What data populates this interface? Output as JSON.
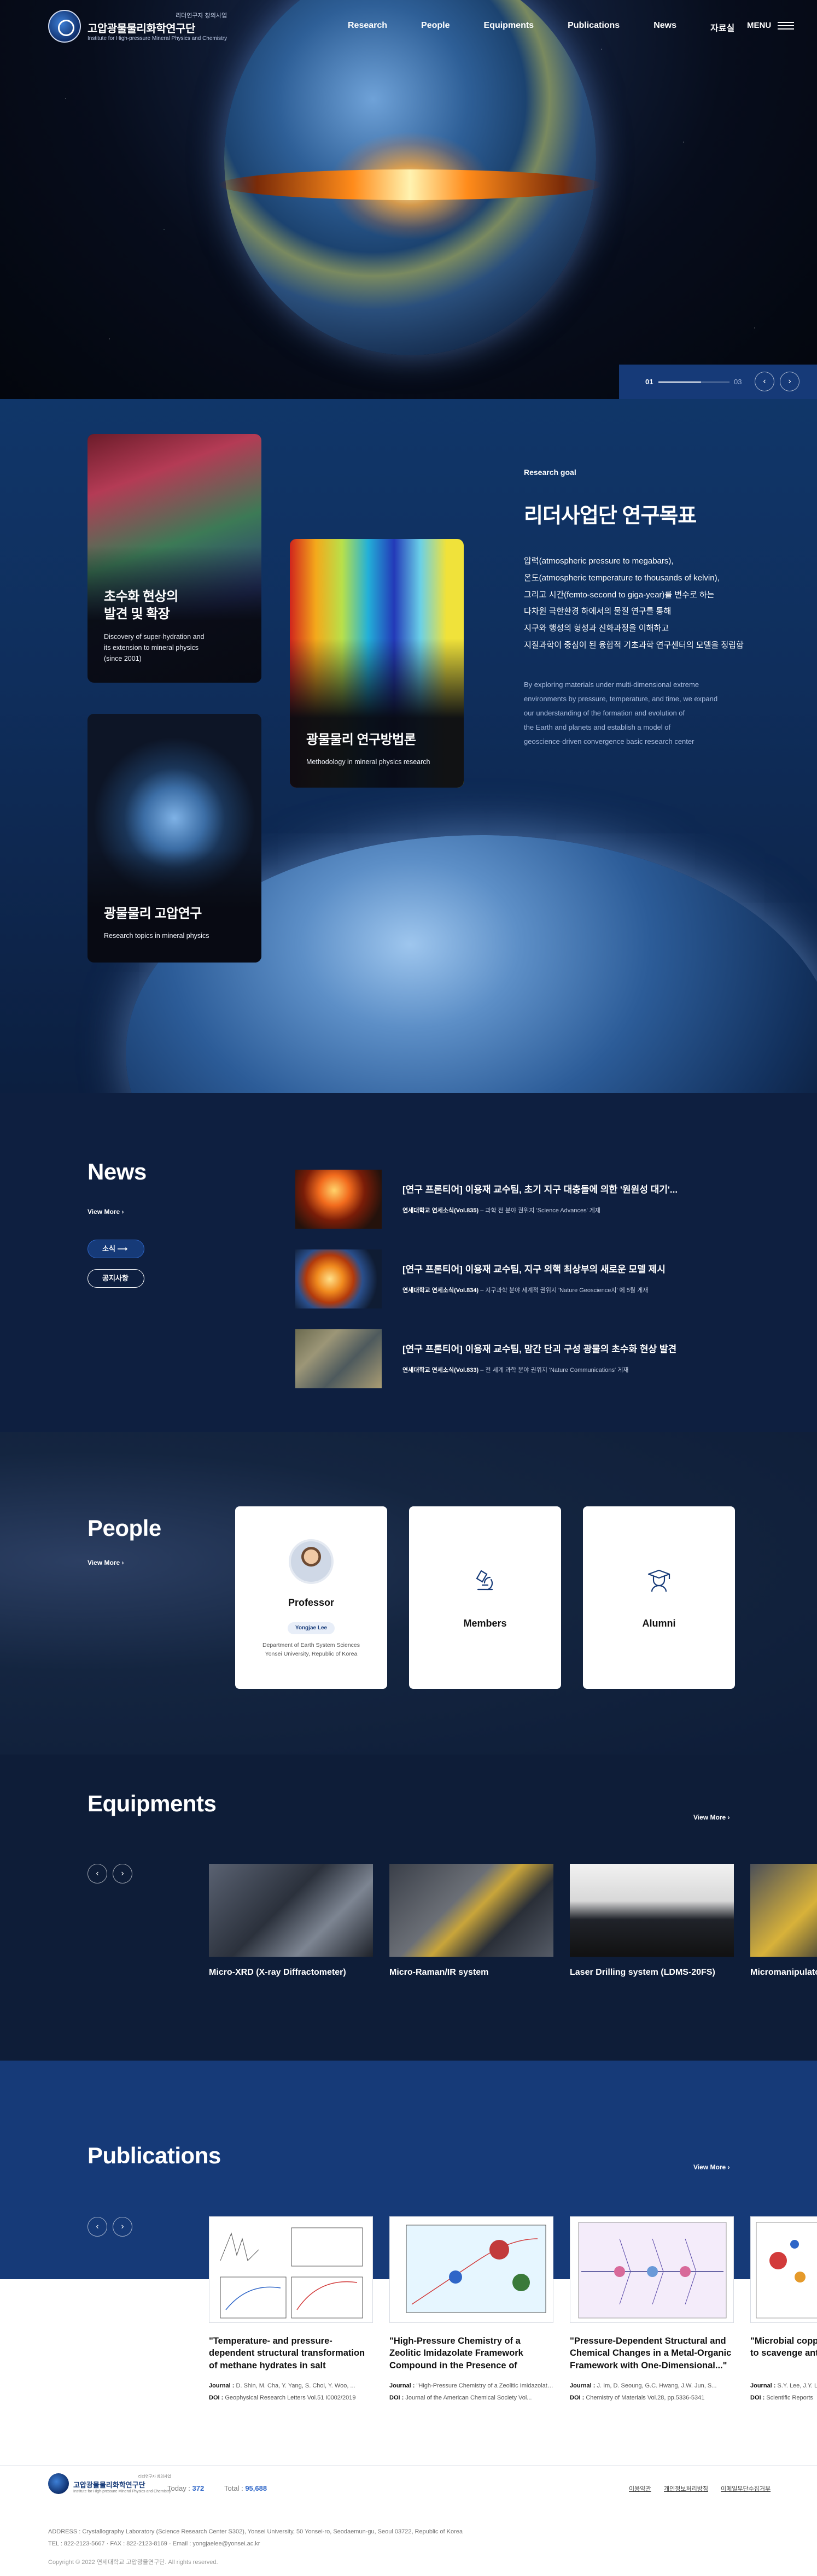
{
  "header": {
    "logo_kicker": "리더연구자 창의사업",
    "logo_name": "고압광물물리화학연구단",
    "logo_eng": "Institute for High-pressure Mineral Physics and Chemistry",
    "nav": [
      "Research",
      "People",
      "Equipments",
      "Publications",
      "News",
      "자료실"
    ],
    "menu_label": "MENU"
  },
  "hero": {
    "current_slide": "01",
    "total_slides": "03",
    "progress": 0.6,
    "prev_glyph": "‹",
    "next_glyph": "›"
  },
  "research": {
    "cards": [
      {
        "title_line1": "초수화 현상의",
        "title_line2": "발견 및 확장",
        "desc_line1": "Discovery of super-hydration and",
        "desc_line2": "its extension to mineral physics",
        "desc_line3": "(since 2001)"
      },
      {
        "title_line1": "광물물리 연구방법론",
        "desc_line1": "Methodology in mineral physics research"
      },
      {
        "title_line1": "광물물리 고압연구",
        "desc_line1": "Research topics in mineral physics"
      }
    ],
    "goal_kicker": "Research goal",
    "goal_title": "리더사업단 연구목표",
    "goal_ko": [
      "압력(atmospheric pressure to megabars),",
      "온도(atmospheric temperature to thousands of kelvin),",
      "그리고 시간(femto-second to giga-year)를 변수로 하는",
      "다차원 극한환경 하에서의 물질 연구를 통해",
      "지구와 행성의 형성과 진화과정을 이해하고",
      "지질과학이 중심이 된 융합적 기초과학 연구센터의 모델을 정립함"
    ],
    "goal_en": [
      "By exploring materials under multi-dimensional extreme",
      "environments by pressure, temperature, and time, we expand",
      "our understanding of the formation and evolution of",
      "the Earth and planets and establish a model of",
      "geoscience-driven convergence basic research center"
    ]
  },
  "news": {
    "title": "News",
    "view_more": "View More",
    "tabs": [
      "소식",
      "공지사항"
    ],
    "items": [
      {
        "title": "[연구 프론티어] 이용재 교수팀, 초기 지구 대충돌에 의한 '원원성 대기'...",
        "source": "연세대학교 연세소식(Vol.835)",
        "note": "과학 전 분야 권위지 'Science Advances' 게재"
      },
      {
        "title": "[연구 프론티어] 이용재 교수팀, 지구 외핵 최상부의 새로운 모델 제시",
        "source": "연세대학교 연세소식(Vol.834)",
        "note": "지구과학 분야 세계적 권위지 'Nature Geoscience지' 에 5월 게재"
      },
      {
        "title": "[연구 프론티어] 이용재 교수팀, 맘간 단괴 구성 광물의 초수화 현상 발견",
        "source": "연세대학교 연세소식(Vol.833)",
        "note": "전 세계 과학 분야 권위지 'Nature Communications' 게재"
      }
    ]
  },
  "people": {
    "title": "People",
    "view_more": "View More",
    "professor": {
      "label": "Professor",
      "name": "Yongjae Lee",
      "dept_line1": "Department of Earth System Sciences",
      "dept_line2": "Yonsei University, Republic of Korea"
    },
    "members_label": "Members",
    "alumni_label": "Alumni"
  },
  "equipments": {
    "title": "Equipments",
    "view_more": "View More",
    "items": [
      "Micro-XRD (X-ray Diffractometer)",
      "Micro-Raman/IR system",
      "Laser Drilling system (LDMS-20FS)",
      "Micromanipulator"
    ]
  },
  "publications": {
    "title": "Publications",
    "view_more": "View More",
    "items": [
      {
        "title": "\"Temperature- and pressure-dependent structural transformation of methane hydrates in salt environments\"",
        "journal": "D. Shin, M. Cha, Y. Yang, S. Choi, Y. Woo, ...",
        "doi": "Geophysical Research Letters Vol.51 I0002/2019"
      },
      {
        "title": "\"High-Pressure Chemistry of a Zeolitic Imidazolate Framework Compound in the Presence of Different Fluids\"",
        "journal": "\"High-Pressure Chemistry of a Zeolitic Imidazolate...\"",
        "doi": "Journal of the American Chemical Society Vol..."
      },
      {
        "title": "\"Pressure-Dependent Structural and Chemical Changes in a Metal-Organic Framework with One-Dimensional...\"",
        "journal": "J. Im, D. Seoung, G.C. Hwang, J.W. Jun, S...",
        "doi": "Chemistry of Materials Vol.28, pp.5336-5341"
      },
      {
        "title": "\"Microbial copper reduction method to scavenge anthropogenic litharge\"",
        "journal": "S.Y. Lee, J.Y. Lee...",
        "doi": "Scientific Reports"
      }
    ],
    "journal_label": "Journal :",
    "doi_label": "DOI :"
  },
  "footer": {
    "logo_kicker": "리더연구자 창의사업",
    "logo_name": "고압광물물리화학연구단",
    "logo_eng": "Institute for High-pressure Mineral Physics and Chemistry",
    "today_label": "Today :",
    "today_value": "372",
    "total_label": "Total :",
    "total_value": "95,688",
    "links": [
      "이용약관",
      "개인정보처리방침",
      "이메일무단수집거부"
    ],
    "address": "ADDRESS : Crystallography Laboratory (Science Research Center S302), Yonsei University, 50 Yonsei-ro, Seodaemun-gu, Seoul 03722, Republic of Korea",
    "contact": "TEL : 822-2123-5667  ·  FAX : 822-2123-8169  ·  Email : yongjaelee@yonsei.ac.kr",
    "copyright": "Copyright © 2022 연세대학교 고압광물연구단. All rights reserved."
  },
  "colors": {
    "navy": "#163a78",
    "accent_blue": "#2f66c8",
    "deep": "#0e1d38"
  }
}
